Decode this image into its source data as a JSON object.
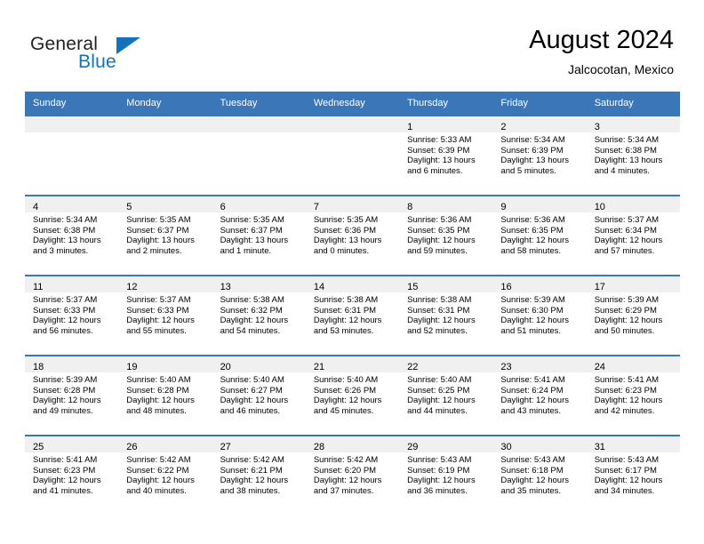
{
  "brand": {
    "name_part1": "General",
    "name_part2": "Blue",
    "logo_icon": "blue-triangle"
  },
  "header": {
    "title": "August 2024",
    "subtitle": "Jalcocotan, Mexico"
  },
  "colors": {
    "header_blue": "#3a76b8",
    "brand_blue": "#1272bc",
    "day_band_gray": "#f0f0f0",
    "text": "#000000"
  },
  "weekdays": [
    "Sunday",
    "Monday",
    "Tuesday",
    "Wednesday",
    "Thursday",
    "Friday",
    "Saturday"
  ],
  "labels": {
    "sunrise_prefix": "Sunrise:",
    "sunset_prefix": "Sunset:",
    "daylight_prefix": "Daylight:"
  },
  "weeks": [
    [
      {
        "day": "",
        "empty": true
      },
      {
        "day": "",
        "empty": true
      },
      {
        "day": "",
        "empty": true
      },
      {
        "day": "",
        "empty": true
      },
      {
        "day": "1",
        "sunrise": "Sunrise: 5:33 AM",
        "sunset": "Sunset: 6:39 PM",
        "daylight_l1": "Daylight: 13 hours",
        "daylight_l2": "and 6 minutes."
      },
      {
        "day": "2",
        "sunrise": "Sunrise: 5:34 AM",
        "sunset": "Sunset: 6:39 PM",
        "daylight_l1": "Daylight: 13 hours",
        "daylight_l2": "and 5 minutes."
      },
      {
        "day": "3",
        "sunrise": "Sunrise: 5:34 AM",
        "sunset": "Sunset: 6:38 PM",
        "daylight_l1": "Daylight: 13 hours",
        "daylight_l2": "and 4 minutes."
      }
    ],
    [
      {
        "day": "4",
        "sunrise": "Sunrise: 5:34 AM",
        "sunset": "Sunset: 6:38 PM",
        "daylight_l1": "Daylight: 13 hours",
        "daylight_l2": "and 3 minutes."
      },
      {
        "day": "5",
        "sunrise": "Sunrise: 5:35 AM",
        "sunset": "Sunset: 6:37 PM",
        "daylight_l1": "Daylight: 13 hours",
        "daylight_l2": "and 2 minutes."
      },
      {
        "day": "6",
        "sunrise": "Sunrise: 5:35 AM",
        "sunset": "Sunset: 6:37 PM",
        "daylight_l1": "Daylight: 13 hours",
        "daylight_l2": "and 1 minute."
      },
      {
        "day": "7",
        "sunrise": "Sunrise: 5:35 AM",
        "sunset": "Sunset: 6:36 PM",
        "daylight_l1": "Daylight: 13 hours",
        "daylight_l2": "and 0 minutes."
      },
      {
        "day": "8",
        "sunrise": "Sunrise: 5:36 AM",
        "sunset": "Sunset: 6:35 PM",
        "daylight_l1": "Daylight: 12 hours",
        "daylight_l2": "and 59 minutes."
      },
      {
        "day": "9",
        "sunrise": "Sunrise: 5:36 AM",
        "sunset": "Sunset: 6:35 PM",
        "daylight_l1": "Daylight: 12 hours",
        "daylight_l2": "and 58 minutes."
      },
      {
        "day": "10",
        "sunrise": "Sunrise: 5:37 AM",
        "sunset": "Sunset: 6:34 PM",
        "daylight_l1": "Daylight: 12 hours",
        "daylight_l2": "and 57 minutes."
      }
    ],
    [
      {
        "day": "11",
        "sunrise": "Sunrise: 5:37 AM",
        "sunset": "Sunset: 6:33 PM",
        "daylight_l1": "Daylight: 12 hours",
        "daylight_l2": "and 56 minutes."
      },
      {
        "day": "12",
        "sunrise": "Sunrise: 5:37 AM",
        "sunset": "Sunset: 6:33 PM",
        "daylight_l1": "Daylight: 12 hours",
        "daylight_l2": "and 55 minutes."
      },
      {
        "day": "13",
        "sunrise": "Sunrise: 5:38 AM",
        "sunset": "Sunset: 6:32 PM",
        "daylight_l1": "Daylight: 12 hours",
        "daylight_l2": "and 54 minutes."
      },
      {
        "day": "14",
        "sunrise": "Sunrise: 5:38 AM",
        "sunset": "Sunset: 6:31 PM",
        "daylight_l1": "Daylight: 12 hours",
        "daylight_l2": "and 53 minutes."
      },
      {
        "day": "15",
        "sunrise": "Sunrise: 5:38 AM",
        "sunset": "Sunset: 6:31 PM",
        "daylight_l1": "Daylight: 12 hours",
        "daylight_l2": "and 52 minutes."
      },
      {
        "day": "16",
        "sunrise": "Sunrise: 5:39 AM",
        "sunset": "Sunset: 6:30 PM",
        "daylight_l1": "Daylight: 12 hours",
        "daylight_l2": "and 51 minutes."
      },
      {
        "day": "17",
        "sunrise": "Sunrise: 5:39 AM",
        "sunset": "Sunset: 6:29 PM",
        "daylight_l1": "Daylight: 12 hours",
        "daylight_l2": "and 50 minutes."
      }
    ],
    [
      {
        "day": "18",
        "sunrise": "Sunrise: 5:39 AM",
        "sunset": "Sunset: 6:28 PM",
        "daylight_l1": "Daylight: 12 hours",
        "daylight_l2": "and 49 minutes."
      },
      {
        "day": "19",
        "sunrise": "Sunrise: 5:40 AM",
        "sunset": "Sunset: 6:28 PM",
        "daylight_l1": "Daylight: 12 hours",
        "daylight_l2": "and 48 minutes."
      },
      {
        "day": "20",
        "sunrise": "Sunrise: 5:40 AM",
        "sunset": "Sunset: 6:27 PM",
        "daylight_l1": "Daylight: 12 hours",
        "daylight_l2": "and 46 minutes."
      },
      {
        "day": "21",
        "sunrise": "Sunrise: 5:40 AM",
        "sunset": "Sunset: 6:26 PM",
        "daylight_l1": "Daylight: 12 hours",
        "daylight_l2": "and 45 minutes."
      },
      {
        "day": "22",
        "sunrise": "Sunrise: 5:40 AM",
        "sunset": "Sunset: 6:25 PM",
        "daylight_l1": "Daylight: 12 hours",
        "daylight_l2": "and 44 minutes."
      },
      {
        "day": "23",
        "sunrise": "Sunrise: 5:41 AM",
        "sunset": "Sunset: 6:24 PM",
        "daylight_l1": "Daylight: 12 hours",
        "daylight_l2": "and 43 minutes."
      },
      {
        "day": "24",
        "sunrise": "Sunrise: 5:41 AM",
        "sunset": "Sunset: 6:23 PM",
        "daylight_l1": "Daylight: 12 hours",
        "daylight_l2": "and 42 minutes."
      }
    ],
    [
      {
        "day": "25",
        "sunrise": "Sunrise: 5:41 AM",
        "sunset": "Sunset: 6:23 PM",
        "daylight_l1": "Daylight: 12 hours",
        "daylight_l2": "and 41 minutes."
      },
      {
        "day": "26",
        "sunrise": "Sunrise: 5:42 AM",
        "sunset": "Sunset: 6:22 PM",
        "daylight_l1": "Daylight: 12 hours",
        "daylight_l2": "and 40 minutes."
      },
      {
        "day": "27",
        "sunrise": "Sunrise: 5:42 AM",
        "sunset": "Sunset: 6:21 PM",
        "daylight_l1": "Daylight: 12 hours",
        "daylight_l2": "and 38 minutes."
      },
      {
        "day": "28",
        "sunrise": "Sunrise: 5:42 AM",
        "sunset": "Sunset: 6:20 PM",
        "daylight_l1": "Daylight: 12 hours",
        "daylight_l2": "and 37 minutes."
      },
      {
        "day": "29",
        "sunrise": "Sunrise: 5:43 AM",
        "sunset": "Sunset: 6:19 PM",
        "daylight_l1": "Daylight: 12 hours",
        "daylight_l2": "and 36 minutes."
      },
      {
        "day": "30",
        "sunrise": "Sunrise: 5:43 AM",
        "sunset": "Sunset: 6:18 PM",
        "daylight_l1": "Daylight: 12 hours",
        "daylight_l2": "and 35 minutes."
      },
      {
        "day": "31",
        "sunrise": "Sunrise: 5:43 AM",
        "sunset": "Sunset: 6:17 PM",
        "daylight_l1": "Daylight: 12 hours",
        "daylight_l2": "and 34 minutes."
      }
    ]
  ]
}
